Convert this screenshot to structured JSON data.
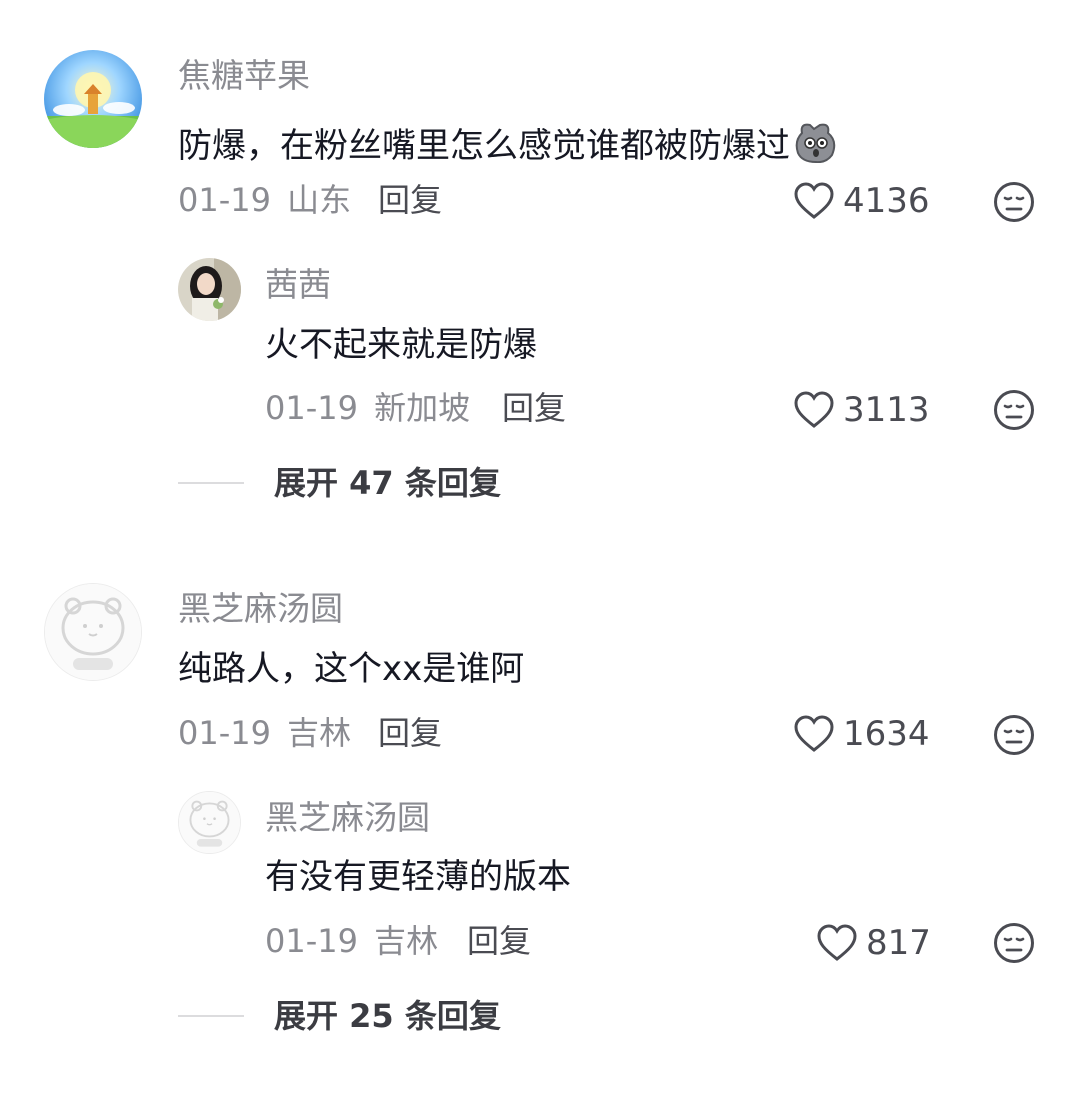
{
  "comments": [
    {
      "author": "焦糖苹果",
      "text": "防爆，在粉丝嘴里怎么感觉谁都被防爆过",
      "date": "01-19",
      "location": "山东",
      "reply_label": "回复",
      "likes": "4136",
      "replies": [
        {
          "author": "茜茜",
          "text": "火不起来就是防爆",
          "date": "01-19",
          "location": "新加坡",
          "reply_label": "回复",
          "likes": "3113"
        }
      ],
      "expand_label": "展开 47 条回复"
    },
    {
      "author": "黑芝麻汤圆",
      "text": "纯路人，这个xx是谁阿",
      "date": "01-19",
      "location": "吉林",
      "reply_label": "回复",
      "likes": "1634",
      "replies": [
        {
          "author": "黑芝麻汤圆",
          "text": "有没有更轻薄的版本",
          "date": "01-19",
          "location": "吉林",
          "reply_label": "回复",
          "likes": "817"
        }
      ],
      "expand_label": "展开 25 条回复"
    }
  ],
  "icons": {
    "like": "heart-outline-icon",
    "dislike": "neutral-face-icon",
    "emoji": "scared-pouch-emoji"
  },
  "colors": {
    "text_primary": "#161823",
    "text_secondary": "#8a8b91",
    "background": "#ffffff"
  }
}
